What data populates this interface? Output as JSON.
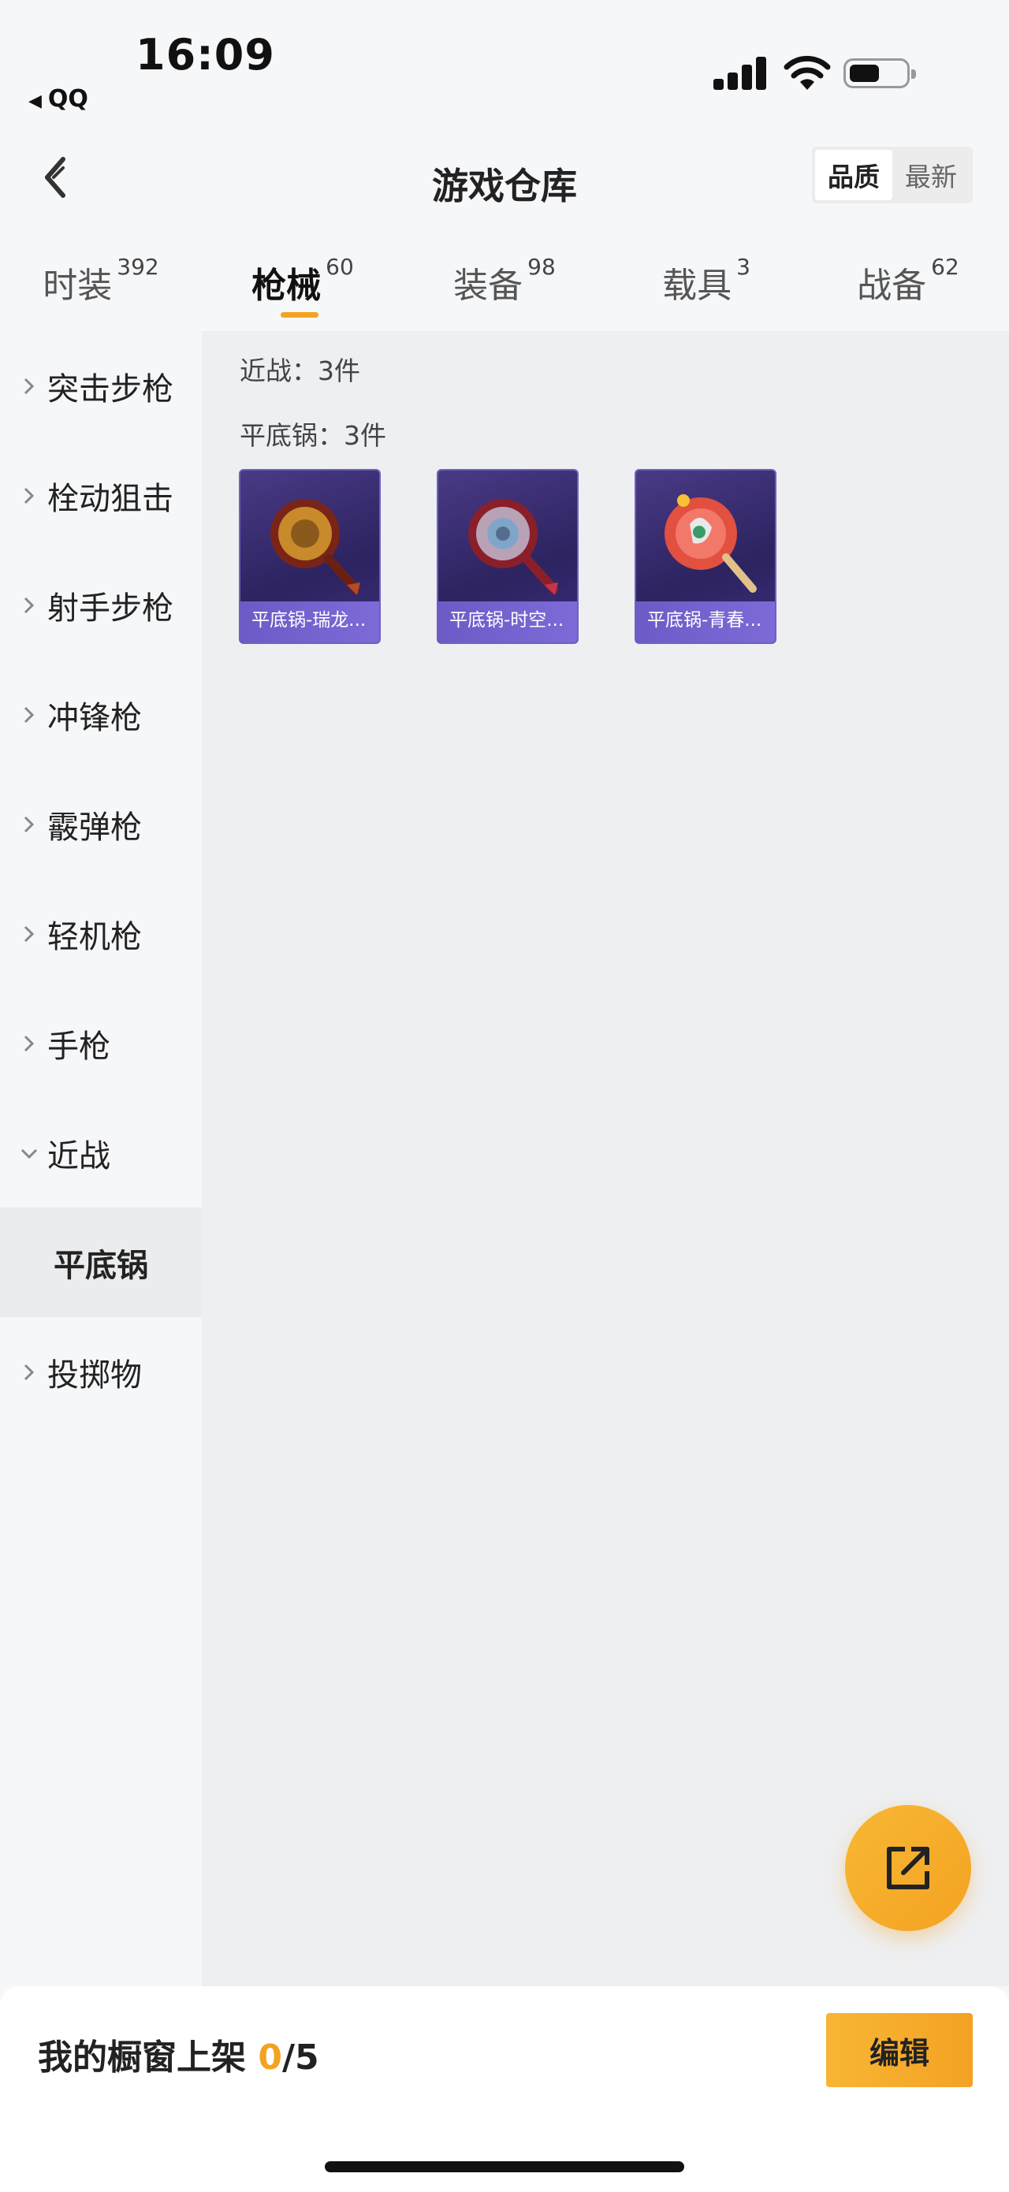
{
  "status_bar": {
    "time": "16:09",
    "back_app": "QQ",
    "signal_icon": "signal-icon",
    "wifi_icon": "wifi-icon",
    "battery_icon": "battery-icon",
    "battery_level": 0.55
  },
  "header": {
    "title": "游戏仓库",
    "back_icon": "chevron-left-icon",
    "sort_options": [
      "品质",
      "最新"
    ],
    "sort_active": 0
  },
  "tabs": [
    {
      "label": "时装",
      "count": "392"
    },
    {
      "label": "枪械",
      "count": "60",
      "active": true
    },
    {
      "label": "装备",
      "count": "98"
    },
    {
      "label": "载具",
      "count": "3"
    },
    {
      "label": "战备",
      "count": "62"
    }
  ],
  "sidebar": {
    "items": [
      {
        "label": "突击步枪"
      },
      {
        "label": "栓动狙击"
      },
      {
        "label": "射手步枪"
      },
      {
        "label": "冲锋枪"
      },
      {
        "label": "霰弹枪"
      },
      {
        "label": "轻机枪"
      },
      {
        "label": "手枪"
      },
      {
        "label": "近战",
        "expanded": true
      },
      {
        "label": "平底锅",
        "sub": true,
        "selected": true
      },
      {
        "label": "投掷物"
      }
    ]
  },
  "content": {
    "category_summary": "近战：3件",
    "subcategory_summary": "平底锅：3件",
    "items": [
      {
        "name": "平底锅-瑞龙...",
        "accent": "#c98a2b"
      },
      {
        "name": "平底锅-时空...",
        "accent": "#7fa6c9"
      },
      {
        "name": "平底锅-青春...",
        "accent": "#e2503f"
      }
    ]
  },
  "fab": {
    "icon": "share-external-icon"
  },
  "bottom_bar": {
    "label": "我的橱窗上架",
    "current": "0",
    "total": "/5",
    "edit_label": "编辑"
  },
  "colors": {
    "accent": "#f3a321",
    "card_bg": "#2c2360",
    "card_name_bar": "#6c5bc7"
  }
}
